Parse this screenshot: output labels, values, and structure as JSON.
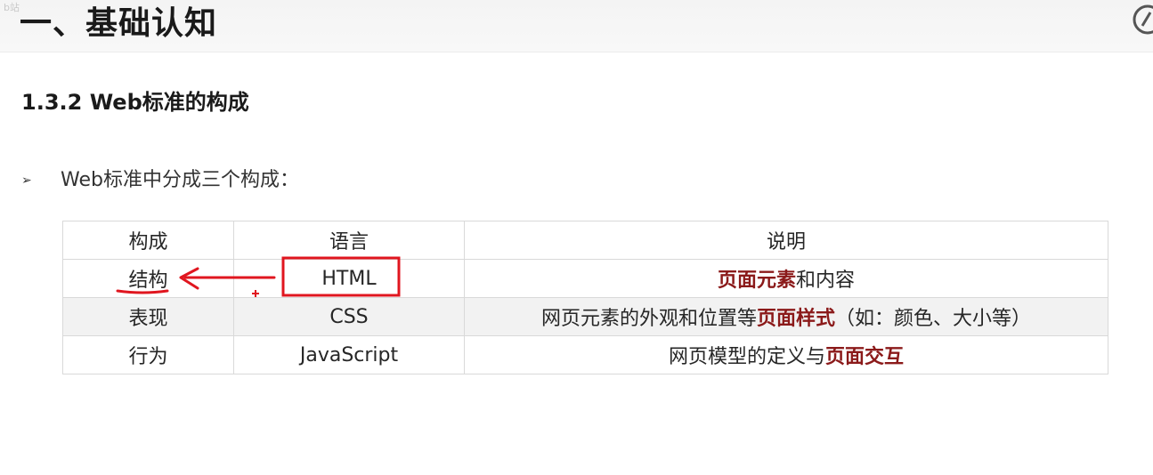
{
  "header": {
    "chapter_title": "一、基础认知",
    "watermark": "b站"
  },
  "section": {
    "title": "1.3.2 Web标准的构成"
  },
  "bullet": {
    "marker": "➢",
    "text": "Web标准中分成三个构成："
  },
  "table": {
    "headers": [
      "构成",
      "语言",
      "说明"
    ],
    "rows": [
      {
        "part": "结构",
        "lang": "HTML",
        "desc_hl": "页面元素",
        "desc_tail": "和内容"
      },
      {
        "part": "表现",
        "lang": "CSS",
        "desc_head": "网页元素的外观和位置等",
        "desc_hl": "页面样式",
        "desc_tail": "（如：颜色、大小等）"
      },
      {
        "part": "行为",
        "lang": "JavaScript",
        "desc_head": "网页模型的定义与",
        "desc_hl": "页面交互"
      }
    ]
  },
  "colors": {
    "highlight": "#8b1a1a",
    "annotation": "#e0161f",
    "table_border": "#d9d9d9",
    "row_shade": "#f2f2f2"
  }
}
